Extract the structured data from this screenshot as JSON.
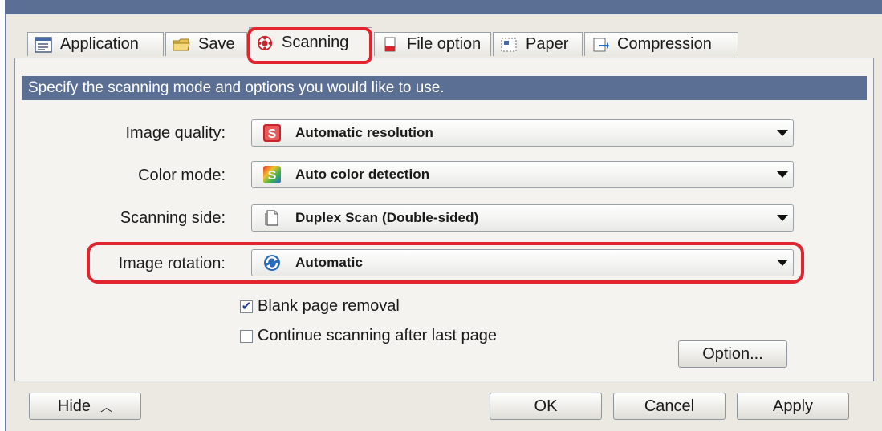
{
  "tabs": [
    {
      "label": "Application",
      "icon": "application-icon"
    },
    {
      "label": "Save",
      "icon": "folder-icon"
    },
    {
      "label": "Scanning",
      "icon": "scanning-icon",
      "active": true
    },
    {
      "label": "File option",
      "icon": "file-option-icon"
    },
    {
      "label": "Paper",
      "icon": "paper-icon"
    },
    {
      "label": "Compression",
      "icon": "compression-icon"
    }
  ],
  "banner": "Specify the scanning mode and options you would like to use.",
  "fields": {
    "image_quality": {
      "label": "Image quality:",
      "value": "Automatic resolution",
      "icon": "red-s-icon"
    },
    "color_mode": {
      "label": "Color mode:",
      "value": "Auto color detection",
      "icon": "color-s-icon"
    },
    "scanning_side": {
      "label": "Scanning side:",
      "value": "Duplex Scan (Double-sided)",
      "icon": "document-icon"
    },
    "image_rotation": {
      "label": "Image rotation:",
      "value": "Automatic",
      "icon": "rotation-icon"
    }
  },
  "checkboxes": {
    "blank_page_removal": {
      "label": "Blank page removal",
      "checked": true
    },
    "continue_scanning": {
      "label": "Continue scanning after last page",
      "checked": false
    }
  },
  "buttons": {
    "option": "Option...",
    "hide": "Hide",
    "ok": "OK",
    "cancel": "Cancel",
    "apply": "Apply"
  },
  "colors": {
    "banner": "#5b6f95",
    "highlight": "#e3242f",
    "check": "#1f3e8a"
  }
}
